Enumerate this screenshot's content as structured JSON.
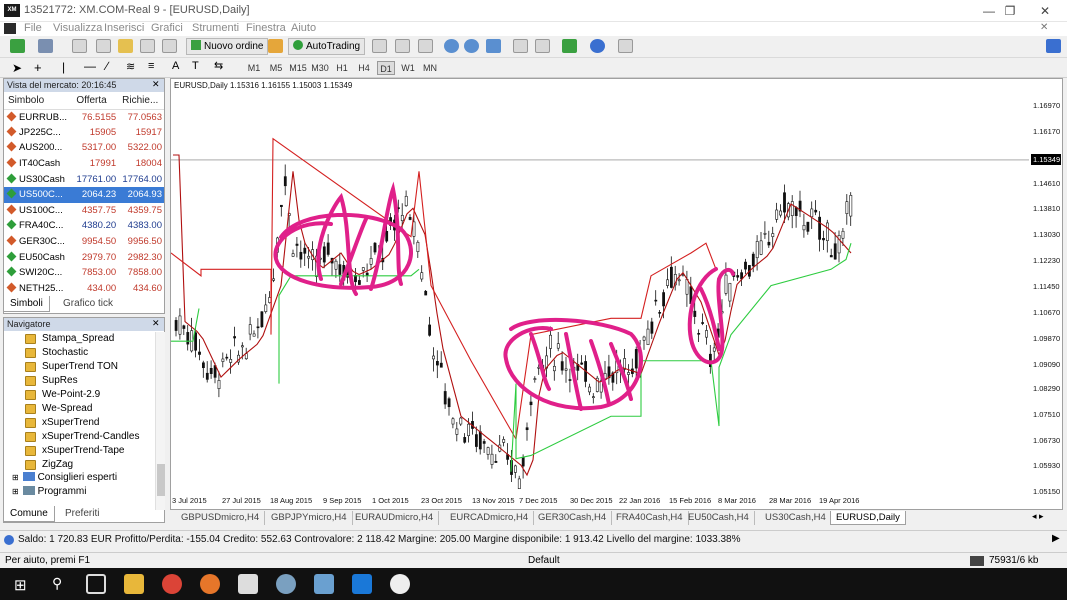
{
  "window": {
    "title": "13521772: XM.COM-Real 9 - [EURUSD,Daily]",
    "logo": "XM"
  },
  "menu": [
    "File",
    "Visualizza",
    "Inserisci",
    "Grafici",
    "Strumenti",
    "Finestra",
    "Aiuto"
  ],
  "toolbar": {
    "new_order": "Nuovo ordine",
    "autotrading": "AutoTrading"
  },
  "timeframes": [
    "M1",
    "M5",
    "M15",
    "M30",
    "H1",
    "H4",
    "D1",
    "W1",
    "MN"
  ],
  "market_watch": {
    "header": "Vista del mercato: 20:16:45",
    "columns": [
      "Simbolo",
      "Offerta",
      "Richie..."
    ],
    "rows": [
      {
        "symbol": "EURRUB...",
        "bid": "76.5155",
        "ask": "77.0563"
      },
      {
        "symbol": "JP225C...",
        "bid": "15905",
        "ask": "15917"
      },
      {
        "symbol": "AUS200...",
        "bid": "5317.00",
        "ask": "5322.00"
      },
      {
        "symbol": "IT40Cash",
        "bid": "17991",
        "ask": "18004"
      },
      {
        "symbol": "US30Cash",
        "bid": "17761.00",
        "ask": "17764.00"
      },
      {
        "symbol": "US500C...",
        "bid": "2064.23",
        "ask": "2064.93"
      },
      {
        "symbol": "US100C...",
        "bid": "4357.75",
        "ask": "4359.75"
      },
      {
        "symbol": "FRA40C...",
        "bid": "4380.20",
        "ask": "4383.00"
      },
      {
        "symbol": "GER30C...",
        "bid": "9954.50",
        "ask": "9956.50"
      },
      {
        "symbol": "EU50Cash",
        "bid": "2979.70",
        "ask": "2982.30"
      },
      {
        "symbol": "SWI20C...",
        "bid": "7853.00",
        "ask": "7858.00"
      },
      {
        "symbol": "NETH25...",
        "bid": "434.00",
        "ask": "434.60"
      }
    ],
    "tabs": [
      "Simboli",
      "Grafico tick"
    ]
  },
  "navigator": {
    "header": "Navigatore",
    "items": [
      "Stampa_Spread",
      "Stochastic",
      "SuperTrend TON",
      "SupRes",
      "We-Point-2.9",
      "We-Spread",
      "xSuperTrend",
      "xSuperTrend-Candles",
      "xSuperTrend-Tape",
      "ZigZag"
    ],
    "folders": [
      "Consiglieri esperti",
      "Programmi"
    ],
    "tabs": [
      "Comune",
      "Preferiti"
    ]
  },
  "chart": {
    "header": "EURUSD,Daily  1.15316 1.16155 1.15003 1.15349",
    "price_ticks": [
      "1.16970",
      "1.16170",
      "1.15349",
      "1.14610",
      "1.13810",
      "1.13030",
      "1.12230",
      "1.11450",
      "1.10670",
      "1.09870",
      "1.09090",
      "1.08290",
      "1.07510",
      "1.06730",
      "1.05930",
      "1.05150"
    ],
    "current_price": "1.15349",
    "date_ticks": [
      "3 Jul 2015",
      "27 Jul 2015",
      "18 Aug 2015",
      "9 Sep 2015",
      "1 Oct 2015",
      "23 Oct 2015",
      "13 Nov 2015",
      "7 Dec 2015",
      "30 Dec 2015",
      "22 Jan 2016",
      "15 Feb 2016",
      "8 Mar 2016",
      "28 Mar 2016",
      "19 Apr 2016"
    ],
    "tabs": [
      "GBPUSDmicro,H4",
      "GBPJPYmicro,H4",
      "EURAUDmicro,H4",
      "EURCADmicro,H4",
      "GER30Cash,H4",
      "FRA40Cash,H4",
      "EU50Cash,H4",
      "US30Cash,H4",
      "EURUSD,Daily"
    ]
  },
  "status": {
    "account": "Saldo: 1 720.83 EUR  Profitto/Perdita: -155.04  Credito: 552.63  Controvalore: 2 118.42  Margine: 205.00  Margine disponibile: 1 913.42  Livello del margine: 1033.38%",
    "help": "Per aiuto, premi F1",
    "profile": "Default",
    "traffic": "75931/6 kb"
  },
  "colors": {
    "bull": "#111111",
    "bear": "#111111",
    "trend_down": "#d42020",
    "trend_up": "#2ecc40",
    "ma": "#b01010",
    "annotation": "#e0208a"
  }
}
